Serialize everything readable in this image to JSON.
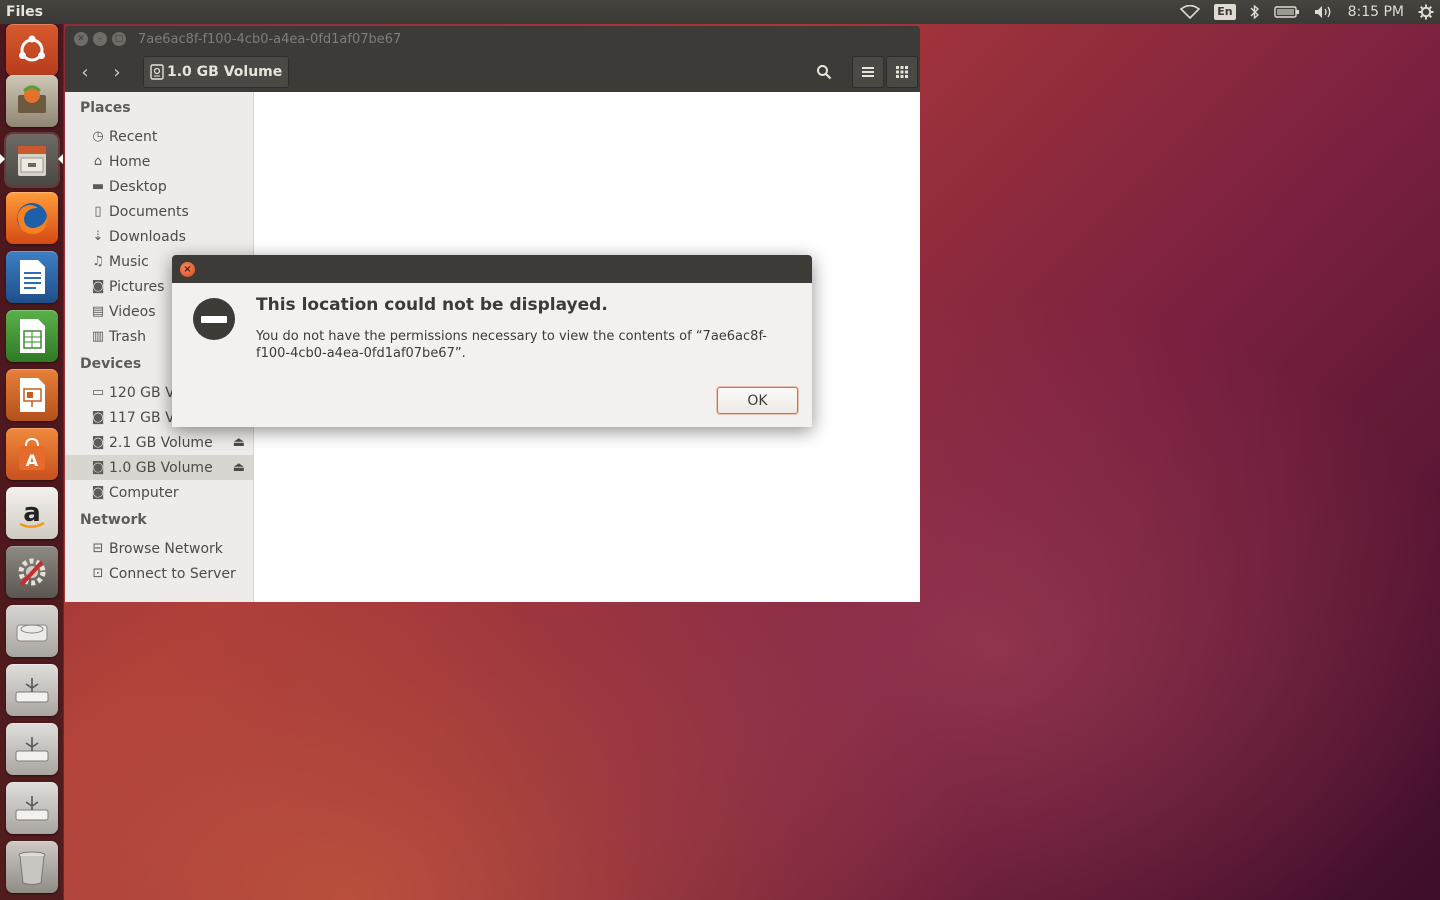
{
  "panel": {
    "app_title": "Files",
    "keyboard_layout": "En",
    "clock": "8:15 PM",
    "icons": [
      "wifi-icon",
      "bluetooth-icon",
      "battery-icon",
      "volume-icon",
      "session-gear-icon"
    ]
  },
  "launcher": {
    "items": [
      "ubuntu-dash",
      "system-installer",
      "files",
      "firefox",
      "libreoffice-writer",
      "libreoffice-calc",
      "libreoffice-impress",
      "ubuntu-software-center",
      "amazon",
      "system-settings",
      "hard-drive",
      "usb-drive",
      "usb-drive",
      "usb-drive",
      "trash"
    ]
  },
  "window": {
    "title": "7ae6ac8f-f100-4cb0-a4ea-0fd1af07be67",
    "path_button": "1.0 GB Volume"
  },
  "sidebar": {
    "places_header": "Places",
    "places": [
      {
        "label": "Recent",
        "icon": "clock-icon"
      },
      {
        "label": "Home",
        "icon": "home-icon"
      },
      {
        "label": "Desktop",
        "icon": "folder-icon"
      },
      {
        "label": "Documents",
        "icon": "document-icon"
      },
      {
        "label": "Downloads",
        "icon": "download-icon"
      },
      {
        "label": "Music",
        "icon": "music-icon"
      },
      {
        "label": "Pictures",
        "icon": "camera-icon"
      },
      {
        "label": "Videos",
        "icon": "film-icon"
      },
      {
        "label": "Trash",
        "icon": "trash-icon"
      }
    ],
    "devices_header": "Devices",
    "devices": [
      {
        "label": "120 GB Volume",
        "icon": "harddisk-icon"
      },
      {
        "label": "117 GB Volume",
        "icon": "drive-icon"
      },
      {
        "label": "2.1 GB Volume",
        "icon": "drive-icon",
        "ejectable": true
      },
      {
        "label": "1.0 GB Volume",
        "icon": "drive-icon",
        "ejectable": true,
        "selected": true
      },
      {
        "label": "Computer",
        "icon": "drive-icon"
      }
    ],
    "network_header": "Network",
    "network": [
      {
        "label": "Browse Network",
        "icon": "network-icon"
      },
      {
        "label": "Connect to Server",
        "icon": "server-icon"
      }
    ]
  },
  "dialog": {
    "heading": "This location could not be displayed.",
    "message": "You do not have the permissions necessary to view the contents of “7ae6ac8f-f100-4cb0-a4ea-0fd1af07be67”.",
    "ok_label": "OK"
  },
  "colors": {
    "accent": "#e46a38",
    "panel": "#3c3b37",
    "sidebar_bg": "#edecea"
  }
}
